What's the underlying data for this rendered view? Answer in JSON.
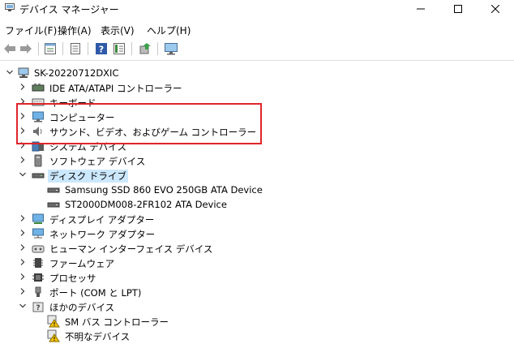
{
  "window": {
    "title": "デバイス マネージャー",
    "minimize_glyph": "—",
    "maximize_glyph": "☐",
    "close_glyph": "✕"
  },
  "menu": [
    {
      "label": "ファイル(F)"
    },
    {
      "label": "操作(A)"
    },
    {
      "label": "表示(V)"
    },
    {
      "label": "ヘルプ(H)"
    }
  ],
  "toolbar_icons": [
    "back-arrow-icon",
    "forward-arrow-icon",
    "properties-icon",
    "list-view-icon",
    "help-icon",
    "details-icon",
    "update-driver-icon",
    "monitor-icon"
  ],
  "tree": {
    "root": "SK-20220712DXIC",
    "items": [
      {
        "label": "IDE ATA/ATAPI コントローラー"
      },
      {
        "label": "キーボード"
      },
      {
        "label": "コンピューター"
      },
      {
        "label": "サウンド、ビデオ、およびゲーム コントローラー"
      },
      {
        "label": "システム デバイス"
      },
      {
        "label": "ソフトウェア デバイス"
      },
      {
        "label": "ディスク ドライブ"
      },
      {
        "label": "Samsung SSD 860 EVO 250GB ATA Device"
      },
      {
        "label": "ST2000DM008-2FR102 ATA Device"
      },
      {
        "label": "ディスプレイ アダプター"
      },
      {
        "label": "ネットワーク アダプター"
      },
      {
        "label": "ヒューマン インターフェイス デバイス"
      },
      {
        "label": "ファームウェア"
      },
      {
        "label": "プロセッサ"
      },
      {
        "label": "ポート (COM と LPT)"
      },
      {
        "label": "ほかのデバイス"
      },
      {
        "label": "SM バス コントローラー"
      },
      {
        "label": "不明なデバイス"
      }
    ]
  },
  "colors": {
    "selection": "#cce8ff",
    "highlight_border": "#e0242b"
  }
}
